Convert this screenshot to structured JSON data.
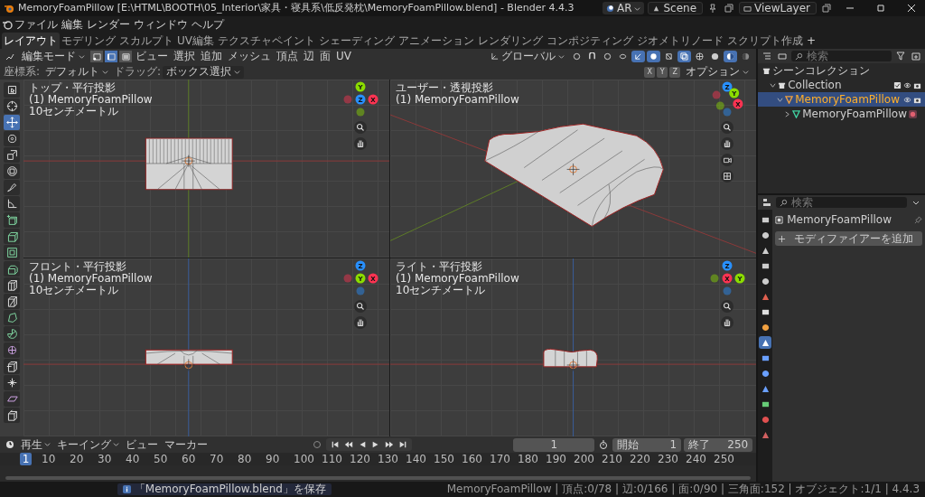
{
  "window": {
    "title": "MemoryFoamPillow [E:\\HTML\\BOOTH\\05_Interior\\家具・寝具系\\低反発枕\\MemoryFoamPillow.blend] - Blender 4.4.3"
  },
  "scene_bar": {
    "engine": "AR",
    "scene": "Scene",
    "view_layer": "ViewLayer"
  },
  "menus": [
    "ファイル",
    "編集",
    "レンダー",
    "ウィンドウ",
    "ヘルプ"
  ],
  "workspaces": [
    {
      "label": "レイアウト",
      "selected": true
    },
    {
      "label": "モデリング",
      "selected": false
    },
    {
      "label": "スカルプト",
      "selected": false
    },
    {
      "label": "UV編集",
      "selected": false
    },
    {
      "label": "テクスチャペイント",
      "selected": false
    },
    {
      "label": "シェーディング",
      "selected": false
    },
    {
      "label": "アニメーション",
      "selected": false
    },
    {
      "label": "レンダリング",
      "selected": false
    },
    {
      "label": "コンポジティング",
      "selected": false
    },
    {
      "label": "ジオメトリノード",
      "selected": false
    },
    {
      "label": "スクリプト作成",
      "selected": false
    }
  ],
  "add_workspace": "+",
  "viewport_header": {
    "mode": "編集モード",
    "select_modes": [
      {
        "kind": "vertex",
        "selected": false
      },
      {
        "kind": "edge",
        "selected": true
      },
      {
        "kind": "face",
        "selected": false
      }
    ],
    "menus": [
      "ビュー",
      "選択",
      "追加",
      "メッシュ",
      "頂点",
      "辺",
      "面",
      "UV"
    ],
    "orientation": "グローバル",
    "toggles": [
      {
        "kind": "pivot",
        "on": false
      },
      {
        "kind": "snap",
        "on": false
      },
      {
        "kind": "proportional",
        "on": false
      },
      {
        "kind": "visibility",
        "on": false
      },
      {
        "kind": "gizmo",
        "on": true
      },
      {
        "kind": "overlay",
        "on": true
      },
      {
        "kind": "mesh-overlay",
        "on": false
      },
      {
        "kind": "xray",
        "on": true
      }
    ],
    "shading": [
      {
        "kind": "wireframe",
        "selected": false
      },
      {
        "kind": "solid",
        "selected": false
      },
      {
        "kind": "material",
        "selected": true
      },
      {
        "kind": "rendered",
        "selected": false
      }
    ]
  },
  "tool_settings": {
    "orientation_label": "座標系:",
    "orientation": "デフォルト",
    "drag_label": "ドラッグ:",
    "drag": "ボックス選択",
    "mirror_axes": [
      "X",
      "Y",
      "Z"
    ],
    "options": "オプション"
  },
  "tools": [
    {
      "kind": "select-box",
      "selected": false
    },
    {
      "kind": "cursor",
      "selected": false
    },
    {
      "kind": "move",
      "selected": true
    },
    {
      "kind": "rotate",
      "selected": false
    },
    {
      "kind": "scale",
      "selected": false
    },
    {
      "kind": "transform",
      "selected": false
    },
    {
      "kind": "annotate",
      "selected": false
    },
    {
      "kind": "measure",
      "selected": false
    },
    {
      "kind": "add-cube",
      "selected": false
    },
    {
      "kind": "extrude",
      "selected": false
    },
    {
      "kind": "inset",
      "selected": false
    },
    {
      "kind": "bevel",
      "selected": false
    },
    {
      "kind": "loop-cut",
      "selected": false
    },
    {
      "kind": "knife",
      "selected": false
    },
    {
      "kind": "poly-build",
      "selected": false
    },
    {
      "kind": "spin",
      "selected": false
    },
    {
      "kind": "smooth",
      "selected": false
    },
    {
      "kind": "edge-slide",
      "selected": false
    },
    {
      "kind": "shrink-fatten",
      "selected": false
    },
    {
      "kind": "shear",
      "selected": false
    },
    {
      "kind": "rip",
      "selected": false
    }
  ],
  "viewports": [
    {
      "kind": "top",
      "view": "トップ・平行投影",
      "object": "(1) MemoryFoamPillow",
      "scale": "10センチメートル",
      "gizmo": [
        {
          "label": "X",
          "color": "#ff3352"
        },
        {
          "label": "Y",
          "color": "#8bdc00"
        },
        {
          "label": "Z",
          "color": "#2890ff"
        }
      ],
      "nav": [
        {
          "kind": "zoom"
        },
        {
          "kind": "pan"
        }
      ]
    },
    {
      "kind": "user",
      "view": "ユーザー・透視投影",
      "object": "(1) MemoryFoamPillow",
      "gizmo": [
        {
          "label": "X",
          "color": "#ff3352"
        },
        {
          "label": "Y",
          "color": "#8bdc00"
        },
        {
          "label": "Z",
          "color": "#2890ff"
        }
      ],
      "nav": [
        {
          "kind": "zoom"
        },
        {
          "kind": "pan"
        },
        {
          "kind": "camera"
        },
        {
          "kind": "grid"
        }
      ]
    },
    {
      "kind": "front",
      "view": "フロント・平行投影",
      "object": "(1) MemoryFoamPillow",
      "scale": "10センチメートル",
      "gizmo": [
        {
          "label": "X",
          "color": "#ff3352"
        },
        {
          "label": "Y",
          "color": "#8bdc00"
        },
        {
          "label": "Z",
          "color": "#2890ff"
        }
      ],
      "nav": [
        {
          "kind": "zoom"
        },
        {
          "kind": "pan"
        }
      ]
    },
    {
      "kind": "right",
      "view": "ライト・平行投影",
      "object": "(1) MemoryFoamPillow",
      "scale": "10センチメートル",
      "gizmo": [
        {
          "label": "X",
          "color": "#ff3352"
        },
        {
          "label": "Y",
          "color": "#8bdc00"
        },
        {
          "label": "Z",
          "color": "#2890ff"
        }
      ],
      "nav": [
        {
          "kind": "zoom"
        },
        {
          "kind": "pan"
        }
      ]
    }
  ],
  "outliner": {
    "search_placeholder": "検索",
    "tree": [
      {
        "kind": "scene",
        "label": "シーンコレクション",
        "selected": false,
        "children": [
          {
            "kind": "collection",
            "label": "Collection",
            "selected": false,
            "expanded": true,
            "checked": true,
            "children": [
              {
                "kind": "object",
                "label": "MemoryFoamPillow",
                "selected": true,
                "expanded": true,
                "children": [
                  {
                    "kind": "mesh",
                    "label": "MemoryFoamPillow",
                    "selected": false,
                    "expanded": false
                  }
                ]
              }
            ]
          }
        ]
      }
    ]
  },
  "properties": {
    "search_placeholder": "検索",
    "tabs": [
      {
        "kind": "tool",
        "selected": false
      },
      {
        "kind": "render",
        "selected": false
      },
      {
        "kind": "output",
        "selected": false
      },
      {
        "kind": "view-layer",
        "selected": false
      },
      {
        "kind": "scene",
        "selected": false
      },
      {
        "kind": "world",
        "selected": false
      },
      {
        "kind": "collection",
        "selected": false
      },
      {
        "kind": "object",
        "selected": false
      },
      {
        "kind": "modifiers",
        "selected": true
      },
      {
        "kind": "particles",
        "selected": false
      },
      {
        "kind": "physics",
        "selected": false
      },
      {
        "kind": "constraints",
        "selected": false
      },
      {
        "kind": "data",
        "selected": false
      },
      {
        "kind": "material",
        "selected": false
      },
      {
        "kind": "texture",
        "selected": false
      }
    ],
    "object_name": "MemoryFoamPillow",
    "add_modifier": "モディファイアーを追加"
  },
  "timeline": {
    "menus": [
      {
        "label": "再生",
        "kind": "dropdown"
      },
      {
        "label": "キーイング",
        "kind": "dropdown"
      },
      {
        "label": "ビュー",
        "kind": "menu"
      },
      {
        "label": "マーカー",
        "kind": "menu"
      }
    ],
    "auto_keying": false,
    "playback": [
      {
        "kind": "jump-start"
      },
      {
        "kind": "prev-key"
      },
      {
        "kind": "play-reverse"
      },
      {
        "kind": "play"
      },
      {
        "kind": "next-key"
      },
      {
        "kind": "jump-end"
      }
    ],
    "current_frame": "1",
    "start_label": "開始",
    "start": "1",
    "end_label": "終了",
    "end": "250",
    "playhead": "1",
    "ruler": [
      "10",
      "20",
      "30",
      "40",
      "50",
      "60",
      "70",
      "80",
      "90",
      "100",
      "110",
      "120",
      "130",
      "140",
      "150",
      "160",
      "170",
      "180",
      "190",
      "200",
      "210",
      "220",
      "230",
      "240",
      "250"
    ]
  },
  "status_bar": {
    "notification": "「MemoryFoamPillow.blend」を保存",
    "stats": "MemoryFoamPillow | 頂点:0/78 | 辺:0/166 | 面:0/90 | 三角面:152 | オブジェクト:1/1 | 4.4.3"
  }
}
